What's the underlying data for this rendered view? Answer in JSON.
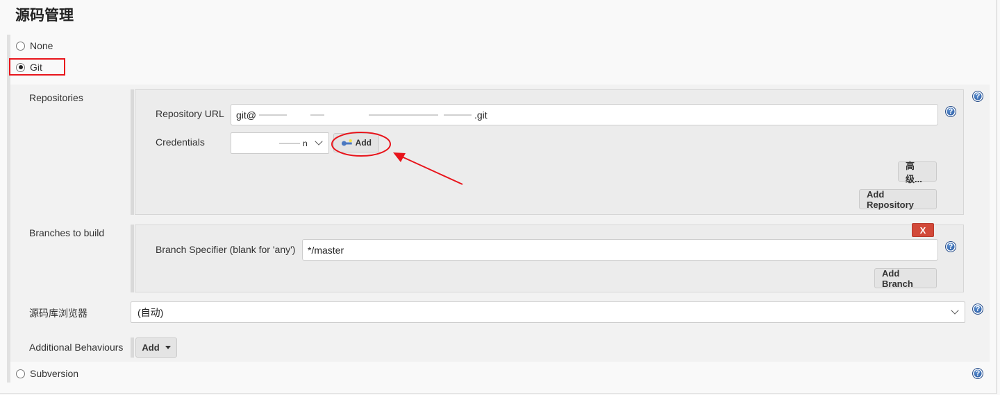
{
  "section": {
    "title": "源码管理"
  },
  "scm_options": {
    "none": "None",
    "git": "Git",
    "subversion": "Subversion",
    "selected": "Git"
  },
  "git": {
    "repositories_label": "Repositories",
    "repository_url_label": "Repository URL",
    "repository_url_prefix": "git@",
    "repository_url_suffix": ".git",
    "credentials_label": "Credentials",
    "credentials_value_suffix": "n",
    "credentials_add_button": "Add",
    "advanced_button": "高级...",
    "add_repository_button": "Add Repository",
    "branches_label": "Branches to build",
    "branch_specifier_label": "Branch Specifier (blank for 'any')",
    "branch_specifier_value": "*/master",
    "delete_branch_button": "X",
    "add_branch_button": "Add Branch",
    "repo_browser_label": "源码库浏览器",
    "repo_browser_value": "(自动)",
    "additional_behaviours_label": "Additional Behaviours",
    "additional_behaviours_add": "Add"
  },
  "icons": {
    "help": "?",
    "credentials_key": "key-icon"
  },
  "colors": {
    "annotation_red": "#e8141b",
    "delete_red": "#d24939",
    "help_blue": "#1f4f98"
  }
}
